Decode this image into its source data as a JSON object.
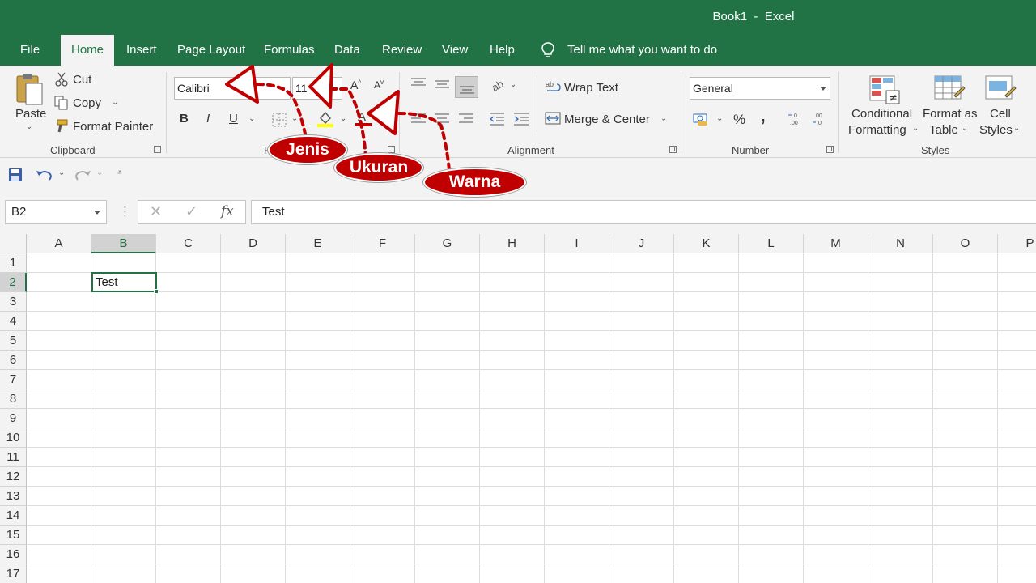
{
  "window": {
    "title": "Book1  -  Excel"
  },
  "tabs": [
    {
      "label": "File"
    },
    {
      "label": "Home",
      "active": true
    },
    {
      "label": "Insert"
    },
    {
      "label": "Page Layout"
    },
    {
      "label": "Formulas"
    },
    {
      "label": "Data"
    },
    {
      "label": "Review"
    },
    {
      "label": "View"
    },
    {
      "label": "Help"
    }
  ],
  "tellme": {
    "icon": "lightbulb-icon",
    "placeholder": "Tell me what you want to do"
  },
  "ribbon": {
    "clipboard": {
      "paste_label": "Paste",
      "cut_label": "Cut",
      "copy_label": "Copy",
      "format_painter_label": "Format Painter",
      "group_label": "Clipboard"
    },
    "font": {
      "font_name": "Calibri",
      "font_size": "11",
      "bold_label": "B",
      "italic_label": "I",
      "underline_label": "U",
      "group_label": "F",
      "font_color": "#c00000",
      "highlight_color": "#ffff00"
    },
    "alignment": {
      "wrap_text_label": "Wrap Text",
      "merge_center_label": "Merge & Center",
      "group_label": "Alignment"
    },
    "number": {
      "format": "General",
      "percent_label": "%",
      "comma_label": ",",
      "group_label": "Number"
    },
    "styles": {
      "conditional_formatting_line1": "Conditional",
      "conditional_formatting_line2": "Formatting",
      "format_as_table_line1": "Format as",
      "format_as_table_line2": "Table",
      "cell_styles_line1": "Cell",
      "cell_styles_line2": "Styles",
      "group_label": "Styles"
    }
  },
  "formula_bar": {
    "name_box": "B2",
    "fx_label": "fx",
    "formula": "Test"
  },
  "sheet": {
    "columns": [
      "A",
      "B",
      "C",
      "D",
      "E",
      "F",
      "G",
      "H",
      "I",
      "J",
      "K",
      "L",
      "M",
      "N",
      "O",
      "P"
    ],
    "rows": [
      "1",
      "2",
      "3",
      "4",
      "5",
      "6",
      "7",
      "8",
      "9",
      "10",
      "11",
      "12",
      "13",
      "14",
      "15",
      "16",
      "17"
    ],
    "selected_column": "B",
    "selected_row": "2",
    "active_cell_value": "Test"
  },
  "annotations": {
    "jenis": "Jenis",
    "ukuran": "Ukuran",
    "warna": "Warna",
    "color": "#c00000"
  },
  "theme": {
    "accent": "#217346"
  }
}
